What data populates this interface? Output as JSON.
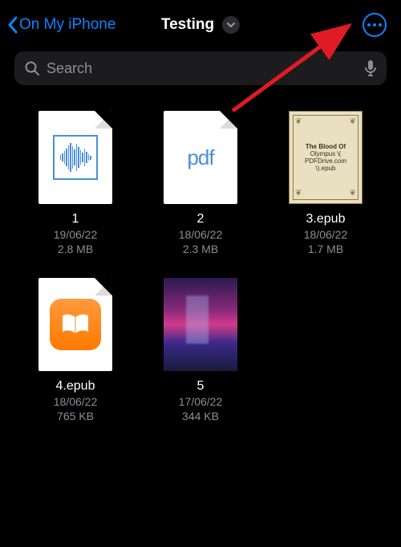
{
  "header": {
    "back_label": "On My iPhone",
    "title": "Testing"
  },
  "search": {
    "placeholder": "Search"
  },
  "files": [
    {
      "name": "1",
      "date": "19/06/22",
      "size": "2.8 MB",
      "thumb_type": "audio"
    },
    {
      "name": "2",
      "date": "18/06/22",
      "size": "2.3 MB",
      "thumb_type": "pdf",
      "thumb_text": "pdf"
    },
    {
      "name": "3.epub",
      "date": "18/06/22",
      "size": "1.7 MB",
      "thumb_type": "vintage",
      "vintage_lines": [
        "The Blood Of",
        "Olympus \\(",
        "PDFDrive.com",
        "\\).epub"
      ]
    },
    {
      "name": "4.epub",
      "date": "18/06/22",
      "size": "765 KB",
      "thumb_type": "ibooks"
    },
    {
      "name": "5",
      "date": "17/06/22",
      "size": "344 KB",
      "thumb_type": "photo"
    }
  ]
}
